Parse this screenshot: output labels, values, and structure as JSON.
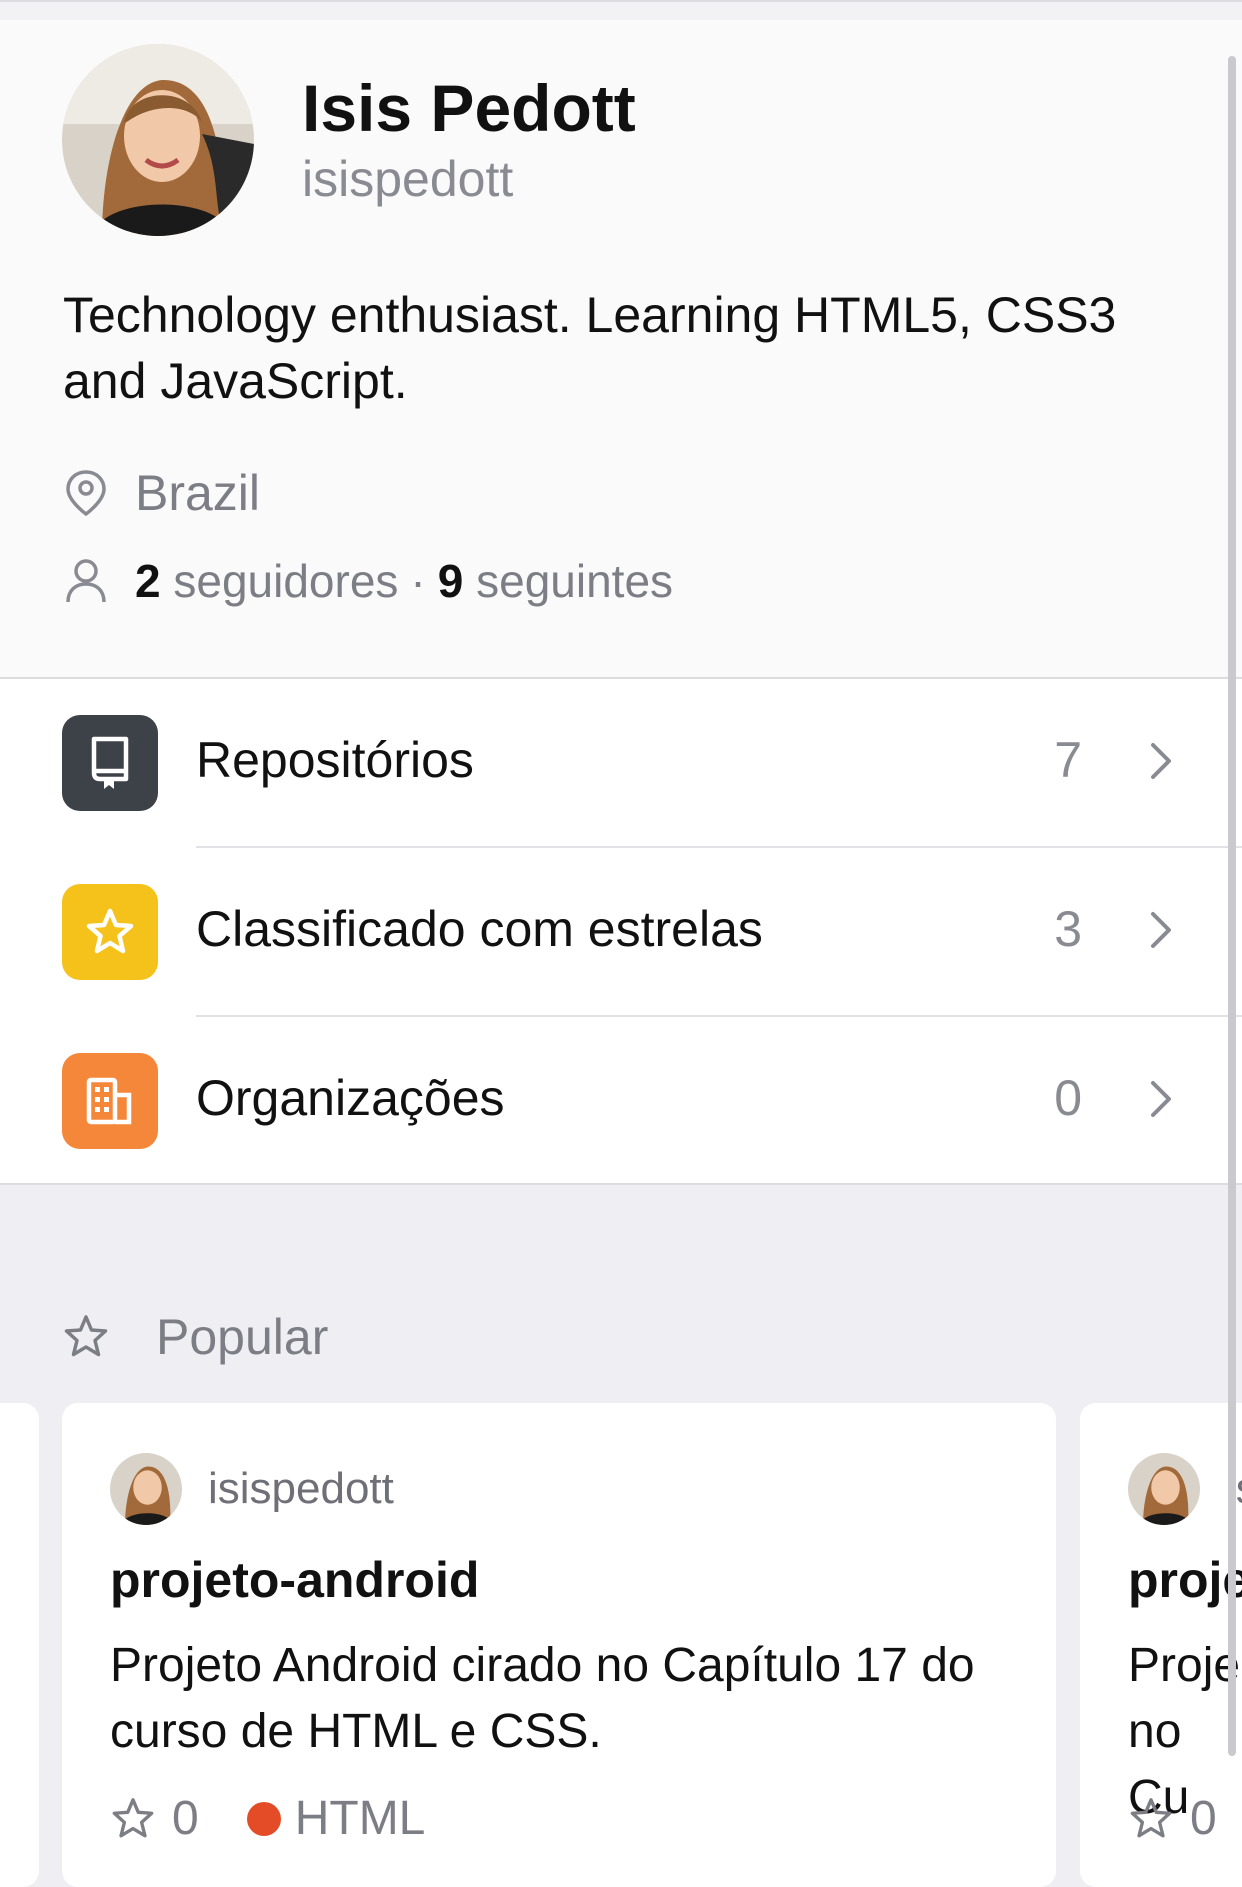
{
  "profile": {
    "name": "Isis Pedott",
    "login": "isispedott",
    "bio": "Technology enthusiast. Learning HTML5, CSS3 and JavaScript.",
    "location": "Brazil",
    "followers_count": "2",
    "followers_label": "seguidores",
    "separator": "·",
    "following_count": "9",
    "following_label": "seguintes"
  },
  "menu": {
    "items": [
      {
        "label": "Repositórios",
        "count": "7",
        "icon": "repo-icon",
        "color": "#3d4148"
      },
      {
        "label": "Classificado com estrelas",
        "count": "3",
        "icon": "star-icon",
        "color": "#f5c21b"
      },
      {
        "label": "Organizações",
        "count": "0",
        "icon": "organization-icon",
        "color": "#f4873a"
      }
    ]
  },
  "popular": {
    "title": "Popular",
    "cards": [
      {
        "owner": "isispedott",
        "name": "projeto-android",
        "description": "Projeto Android cirado no Capítulo 17 do curso de HTML e CSS.",
        "stars": "0",
        "language": "HTML",
        "language_color": "#e34c26"
      },
      {
        "owner": "is",
        "name": "proje",
        "description": "Proje no Cu",
        "stars": "0"
      }
    ]
  }
}
